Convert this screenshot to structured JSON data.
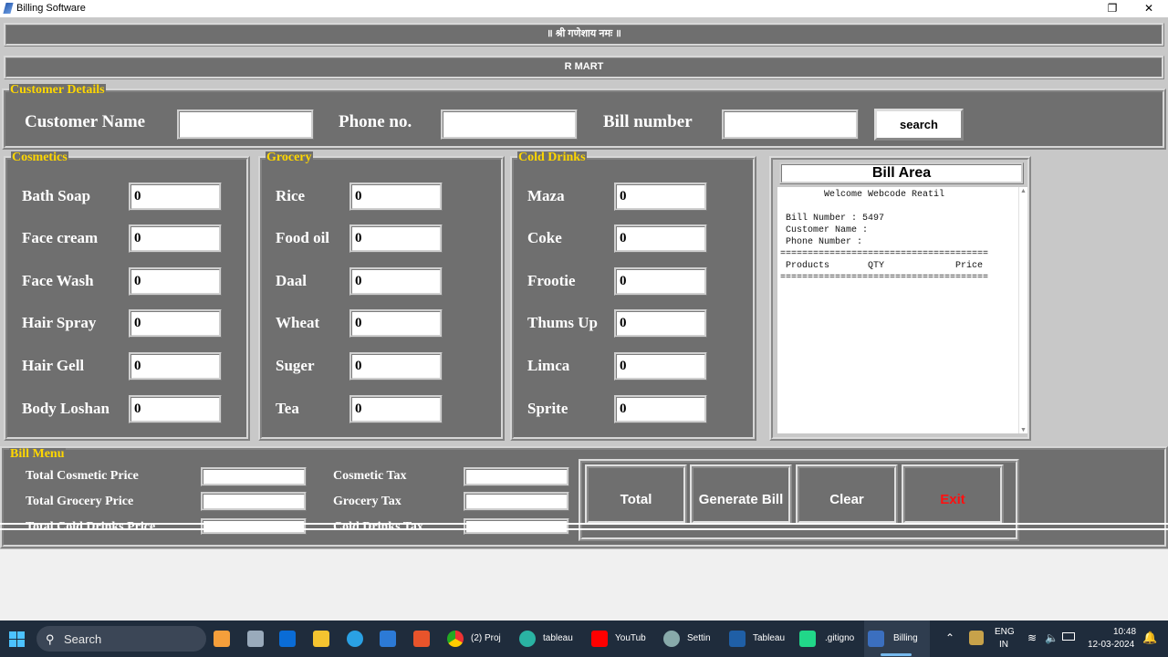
{
  "window": {
    "title": "Billing Software",
    "restore_glyph": "❐",
    "close_glyph": "✕"
  },
  "banner": {
    "invocation": "॥ श्री गणेशाय नमः ॥",
    "store_name": "R MART"
  },
  "customer": {
    "legend": "Customer Details",
    "name_label": "Customer Name",
    "name_value": "",
    "phone_label": "Phone no.",
    "phone_value": "",
    "bill_label": "Bill number",
    "bill_value": "",
    "search_label": "search"
  },
  "cosmetics": {
    "legend": "Cosmetics",
    "items": [
      {
        "label": "Bath Soap",
        "qty": "0"
      },
      {
        "label": "Face cream",
        "qty": "0"
      },
      {
        "label": "Face Wash",
        "qty": "0"
      },
      {
        "label": "Hair Spray",
        "qty": "0"
      },
      {
        "label": "Hair Gell",
        "qty": "0"
      },
      {
        "label": "Body Loshan",
        "qty": "0"
      }
    ]
  },
  "grocery": {
    "legend": "Grocery",
    "items": [
      {
        "label": "Rice",
        "qty": "0"
      },
      {
        "label": "Food oil",
        "qty": "0"
      },
      {
        "label": "Daal",
        "qty": "0"
      },
      {
        "label": "Wheat",
        "qty": "0"
      },
      {
        "label": "Suger",
        "qty": "0"
      },
      {
        "label": "Tea",
        "qty": "0"
      }
    ]
  },
  "cold_drinks": {
    "legend": "Cold Drinks",
    "items": [
      {
        "label": "Maza",
        "qty": "0"
      },
      {
        "label": "Coke",
        "qty": "0"
      },
      {
        "label": "Frootie",
        "qty": "0"
      },
      {
        "label": "Thums Up",
        "qty": "0"
      },
      {
        "label": "Limca",
        "qty": "0"
      },
      {
        "label": "Sprite",
        "qty": "0"
      }
    ]
  },
  "bill_area": {
    "title": "Bill Area",
    "text": "        Welcome Webcode Reatil\n\n Bill Number : 5497\n Customer Name :\n Phone Number :\n======================================\n Products       QTY             Price\n======================================"
  },
  "bill_menu": {
    "legend": "Bill Menu",
    "total_cosmetic_label": "Total Cosmetic Price",
    "total_grocery_label": "Total Grocery Price",
    "total_colddrinks_label": "Total Cold Drinks Price",
    "cosmetic_tax_label": "Cosmetic Tax",
    "grocery_tax_label": "Grocery Tax",
    "colddrinks_tax_label": "Cold Drinks Tax",
    "total_btn": "Total",
    "generate_btn": "Generate Bill",
    "clear_btn": "Clear",
    "exit_btn": "Exit"
  },
  "taskbar": {
    "search_placeholder": "Search",
    "items": [
      {
        "label": "(2) Proj",
        "icon": "chrome-icon"
      },
      {
        "label": "tableau",
        "icon": "edge-icon"
      },
      {
        "label": "YouTub",
        "icon": "youtube-icon"
      },
      {
        "label": "Settin",
        "icon": "settings-icon"
      },
      {
        "label": "Tableau",
        "icon": "tableau-icon"
      },
      {
        "label": ".gitigno",
        "icon": "pycharm-icon"
      },
      {
        "label": "Billing",
        "icon": "python-icon"
      }
    ],
    "lang_top": "ENG",
    "lang_bottom": "IN",
    "time": "10:48",
    "date": "12-03-2024"
  },
  "colors": {
    "panel": "#6f6f6f",
    "legend": "#ffd700",
    "exit": "#ff1010",
    "taskbar": "#1f2c3c"
  }
}
